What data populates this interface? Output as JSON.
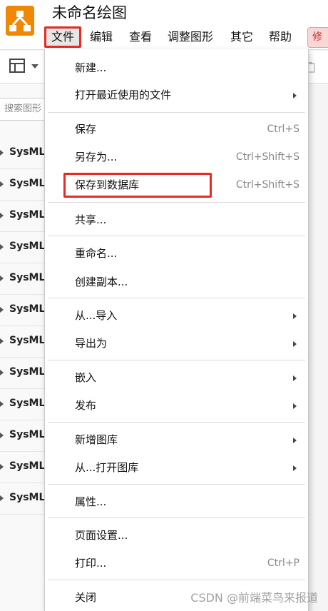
{
  "header": {
    "title": "未命名绘图",
    "menu": [
      {
        "label": "文件",
        "active": true
      },
      {
        "label": "编辑"
      },
      {
        "label": "查看"
      },
      {
        "label": "调整图形"
      },
      {
        "label": "其它"
      },
      {
        "label": "帮助"
      }
    ],
    "badge": "修"
  },
  "sidebar": {
    "search_placeholder": "搜索图形",
    "items": [
      "SysML",
      "SysML",
      "SysML",
      "SysML",
      "SysML",
      "SysML",
      "SysML",
      "SysML",
      "SysML",
      "SysML",
      "SysML",
      "SysML"
    ]
  },
  "file_menu": {
    "items": [
      {
        "label": "新建...",
        "shortcut": "",
        "submenu": false
      },
      {
        "label": "打开最近使用的文件",
        "shortcut": "",
        "submenu": true
      },
      {
        "label": "保存",
        "shortcut": "Ctrl+S",
        "submenu": false
      },
      {
        "label": "另存为...",
        "shortcut": "Ctrl+Shift+S",
        "submenu": false
      },
      {
        "label": "保存到数据库",
        "shortcut": "Ctrl+Shift+S",
        "submenu": false,
        "highlighted": true
      },
      {
        "label": "共享...",
        "shortcut": "",
        "submenu": false
      },
      {
        "label": "重命名...",
        "shortcut": "",
        "submenu": false
      },
      {
        "label": "创建副本...",
        "shortcut": "",
        "submenu": false
      },
      {
        "label": "从...导入",
        "shortcut": "",
        "submenu": true
      },
      {
        "label": "导出为",
        "shortcut": "",
        "submenu": true
      },
      {
        "label": "嵌入",
        "shortcut": "",
        "submenu": true
      },
      {
        "label": "发布",
        "shortcut": "",
        "submenu": true
      },
      {
        "label": "新增图库",
        "shortcut": "",
        "submenu": true
      },
      {
        "label": "从...打开图库",
        "shortcut": "",
        "submenu": true
      },
      {
        "label": "属性...",
        "shortcut": "",
        "submenu": false
      },
      {
        "label": "页面设置...",
        "shortcut": "",
        "submenu": false
      },
      {
        "label": "打印...",
        "shortcut": "Ctrl+P",
        "submenu": false
      },
      {
        "label": "关闭",
        "shortcut": "",
        "submenu": false
      }
    ]
  },
  "watermark": "CSDN @前端菜鸟来报道",
  "colors": {
    "brand": "#f08705",
    "highlight": "#e52b23"
  }
}
